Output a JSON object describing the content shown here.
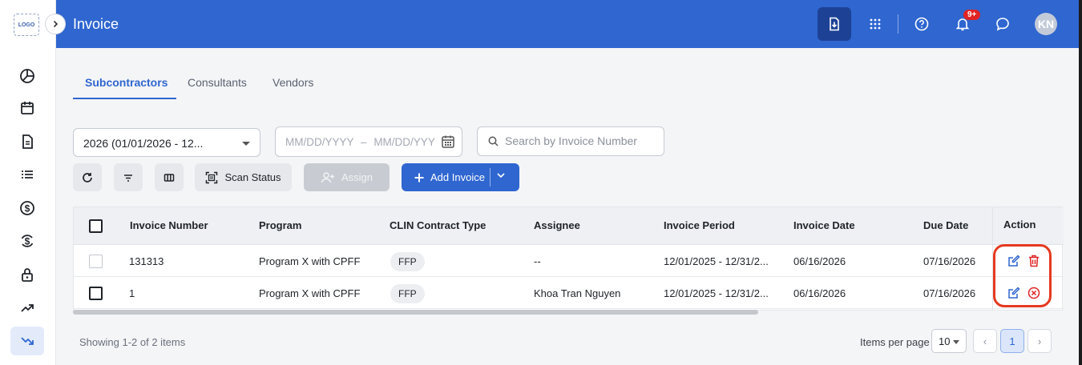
{
  "app": {
    "logo_text": "LOGO",
    "title": "Invoice",
    "notifications_badge": "9+",
    "user_initials": "KN"
  },
  "rail": {
    "items": [
      {
        "name": "dashboard",
        "icon": "pie-chart-icon"
      },
      {
        "name": "calendar",
        "icon": "calendar-icon"
      },
      {
        "name": "documents",
        "icon": "document-icon"
      },
      {
        "name": "list",
        "icon": "list-icon"
      },
      {
        "name": "billing",
        "icon": "dollar-icon"
      },
      {
        "name": "payments",
        "icon": "dollar-sync-icon"
      },
      {
        "name": "security",
        "icon": "lock-icon"
      },
      {
        "name": "trending-up",
        "icon": "trending-up-icon"
      },
      {
        "name": "trending-down",
        "icon": "trending-down-icon",
        "active": true
      }
    ]
  },
  "tabs": [
    {
      "label": "Subcontractors",
      "active": true
    },
    {
      "label": "Consultants",
      "active": false
    },
    {
      "label": "Vendors",
      "active": false
    }
  ],
  "filters": {
    "year_select": "2026 (01/01/2026 - 12...",
    "date_start_placeholder": "MM/DD/YYYY",
    "date_separator": "–",
    "date_end_placeholder": "MM/DD/YYY",
    "search_placeholder": "Search by Invoice Number"
  },
  "toolbar": {
    "scan_status": "Scan Status",
    "assign": "Assign",
    "add_invoice": "Add Invoice"
  },
  "table": {
    "columns": [
      "Invoice Number",
      "Program",
      "CLIN Contract Type",
      "Assignee",
      "Invoice Period",
      "Invoice Date",
      "Due Date",
      "Action"
    ],
    "rows": [
      {
        "invoice_number": "131313",
        "program": "Program X with CPFF",
        "clin": "FFP",
        "assignee": "--",
        "period": "12/01/2025 - 12/31/2...",
        "invoice_date": "06/16/2026",
        "due_date": "07/16/2026",
        "actions": [
          "edit-icon",
          "trash-icon"
        ]
      },
      {
        "invoice_number": "1",
        "program": "Program X with CPFF",
        "clin": "FFP",
        "assignee": "Khoa Tran Nguyen",
        "period": "12/01/2025 - 12/31/2...",
        "invoice_date": "06/16/2026",
        "due_date": "07/16/2026",
        "actions": [
          "edit-icon",
          "cancel-circle-icon"
        ]
      }
    ]
  },
  "footer": {
    "showing": "Showing 1-2 of 2 items",
    "items_per_page_label": "Items per page",
    "items_per_page": "10",
    "current_page": "1",
    "prev": "‹",
    "next": "›"
  },
  "colors": {
    "primary": "#2f66d0",
    "header_action_bg": "#1d4295",
    "danger": "#e02424",
    "highlight": "#e5391f"
  }
}
